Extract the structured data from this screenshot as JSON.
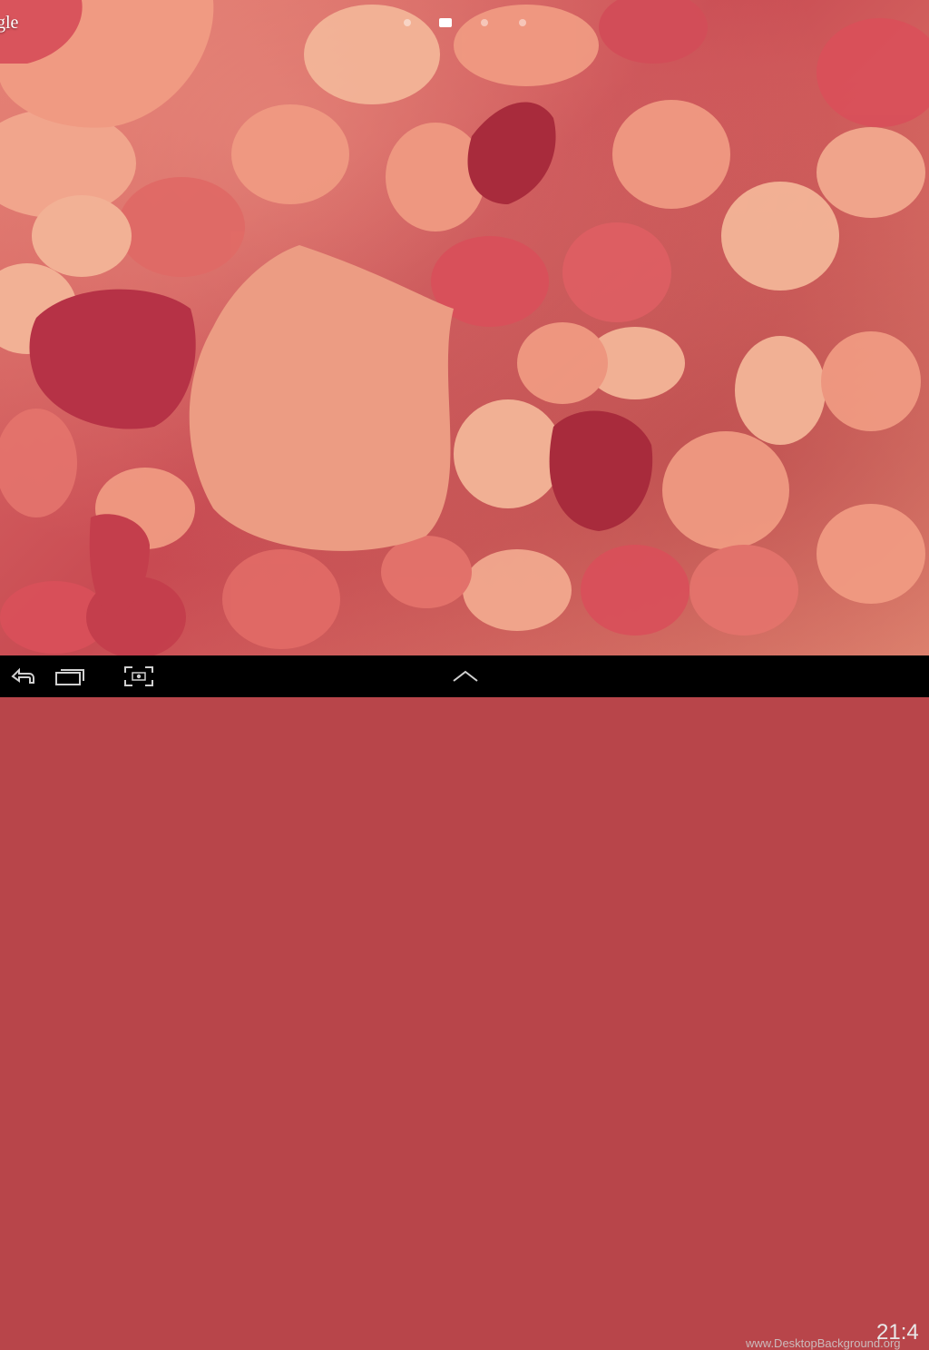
{
  "wallpaper": {
    "description": "rose petals live wallpaper",
    "colors": {
      "base": "#b8454a",
      "light_petal": "#f09a82",
      "mid_petal": "#e06a66",
      "deep_petal": "#a82b3c",
      "pale_petal": "#f4b598"
    }
  },
  "home": {
    "google_label": "gle",
    "page_indicator": {
      "count": 4,
      "active_index": 1
    }
  },
  "navbar": {
    "buttons": [
      {
        "name": "back",
        "icon": "back-arrow-icon"
      },
      {
        "name": "recent_apps",
        "icon": "recent-apps-icon"
      },
      {
        "name": "screenshot",
        "icon": "screenshot-icon"
      },
      {
        "name": "app_drawer",
        "icon": "chevron-up-icon"
      }
    ],
    "watermark": "www.DesktopBackground.org",
    "clock": "21:4"
  },
  "colors": {
    "navbar_bg": "#000000",
    "navbar_icon": "#d0d0d0",
    "clock_text": "#e8e8e8"
  }
}
